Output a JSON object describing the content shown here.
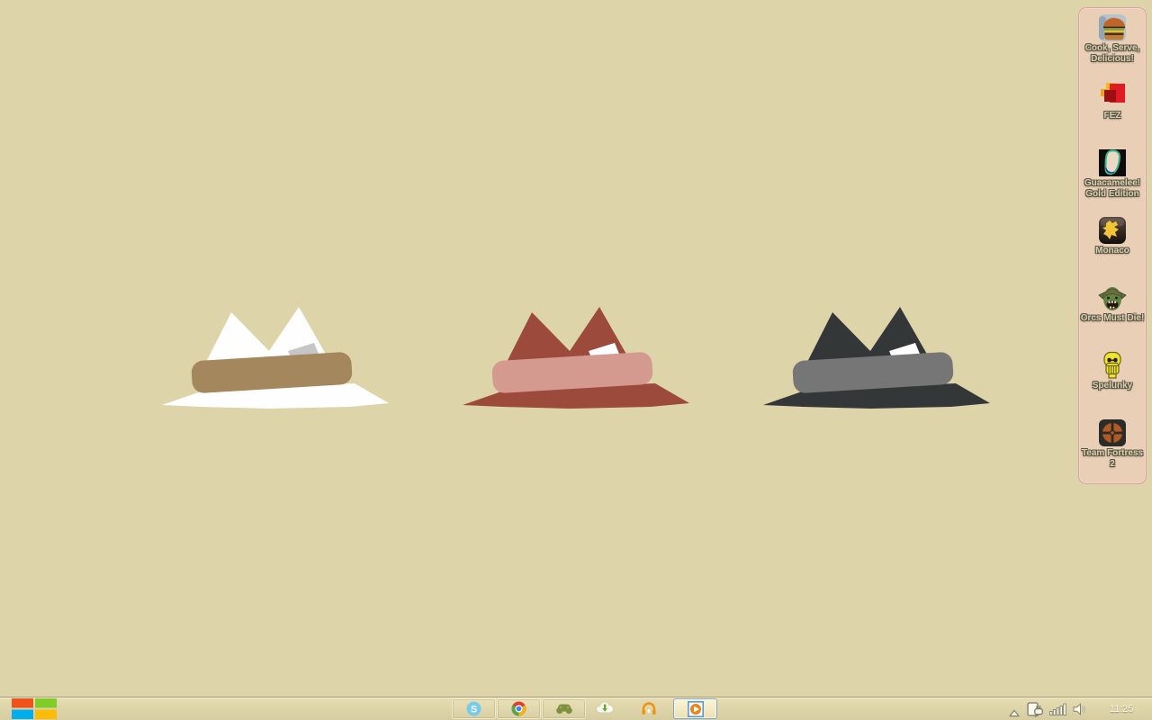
{
  "desktop": {
    "background_color": "#ded4a9",
    "hats": [
      {
        "name": "white-hat",
        "crown": "#fefefe",
        "brim": "#fefefe",
        "band": "#a4875c",
        "card": "#c6c6c6"
      },
      {
        "name": "maroon-hat",
        "crown": "#9c4a3c",
        "brim": "#9c4a3c",
        "band": "#d49a90",
        "card": "#ffffff"
      },
      {
        "name": "charcoal-hat",
        "crown": "#343738",
        "brim": "#343738",
        "band": "#767676",
        "card": "#ffffff"
      }
    ]
  },
  "sidebar": {
    "panel_background": "#e8cfb5",
    "panel_border": "#dda2a0",
    "items": [
      {
        "icon": "cook-serve-delicious-icon",
        "line1": "Cook, Serve,",
        "line2": "Delicious!"
      },
      {
        "icon": "fez-icon",
        "line1": "FEZ"
      },
      {
        "icon": "guacamelee-icon",
        "line1": "Guacamelee!",
        "line2": "Gold Edition"
      },
      {
        "icon": "monaco-icon",
        "line1": "Monaco"
      },
      {
        "icon": "orcs-must-die-icon",
        "line1": "Orcs Must Die!"
      },
      {
        "icon": "spelunky-icon",
        "line1": "Spelunky"
      },
      {
        "icon": "team-fortress-2-icon",
        "line1": "Team Fortress",
        "line2": "2"
      }
    ]
  },
  "taskbar": {
    "start": {
      "colors": [
        "#f1511b",
        "#80cc28",
        "#00adef",
        "#fbbc09"
      ]
    },
    "pinned_buttons": [
      {
        "icon": "skype-icon"
      },
      {
        "icon": "chrome-icon"
      },
      {
        "icon": "game-controller-icon"
      }
    ],
    "loose_icons": [
      {
        "icon": "cloud-download-icon"
      },
      {
        "icon": "headphones-icon"
      }
    ],
    "active_button": {
      "icon": "media-player-icon"
    },
    "system_tray": {
      "icons": [
        "chevron-up-icon",
        "plug-icon",
        "signal-bars-icon",
        "speaker-icon"
      ],
      "clock": "11:25"
    }
  }
}
